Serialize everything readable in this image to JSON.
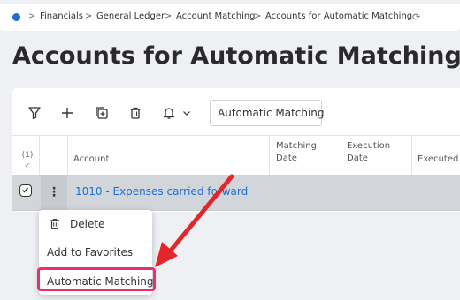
{
  "breadcrumb": {
    "items": [
      "Financials",
      "General Ledger",
      "Account Matching",
      "Accounts for Automatic Matching"
    ],
    "separator": ">"
  },
  "page": {
    "title": "Accounts for Automatic Matching"
  },
  "toolbar": {
    "search_value": "Automatic Matching"
  },
  "table": {
    "selected_count": "(1)",
    "columns": {
      "account": "Account",
      "matching_date_1": "Matching",
      "matching_date_2": "Date",
      "execution_date_1": "Execution",
      "execution_date_2": "Date",
      "executed_by": "Executed B"
    },
    "rows": [
      {
        "account": "1010 - Expenses carried forward"
      }
    ]
  },
  "context_menu": {
    "items": [
      {
        "label": "Delete"
      },
      {
        "label": "Add to Favorites"
      },
      {
        "label": "Automatic Matching"
      }
    ]
  },
  "colors": {
    "accent": "#1f6fd1",
    "highlight": "#e8306a",
    "arrow": "#e3262b",
    "selected_row": "#d2d5da"
  }
}
